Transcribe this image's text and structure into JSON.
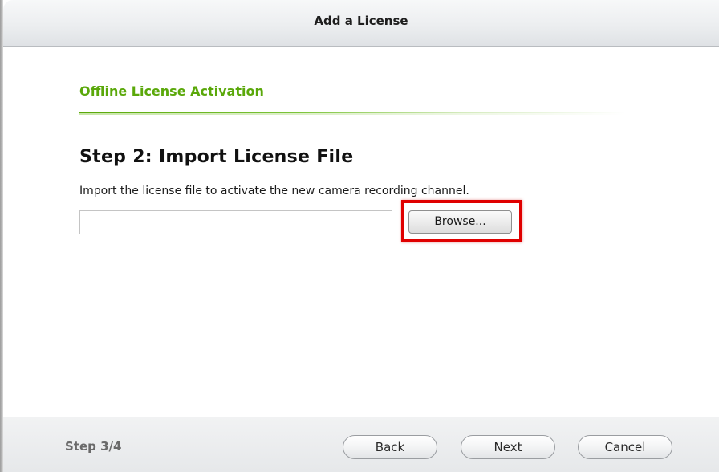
{
  "window": {
    "title": "Add a License"
  },
  "section": {
    "title": "Offline License Activation",
    "accent_color": "#5aa80a"
  },
  "step": {
    "heading": "Step 2: Import License File",
    "description": "Import the license file to activate the new camera recording channel."
  },
  "file_picker": {
    "value": "",
    "browse_label": "Browse...",
    "highlight_color": "#e00000"
  },
  "footer": {
    "step_indicator": "Step 3/4",
    "back_label": "Back",
    "next_label": "Next",
    "cancel_label": "Cancel"
  }
}
